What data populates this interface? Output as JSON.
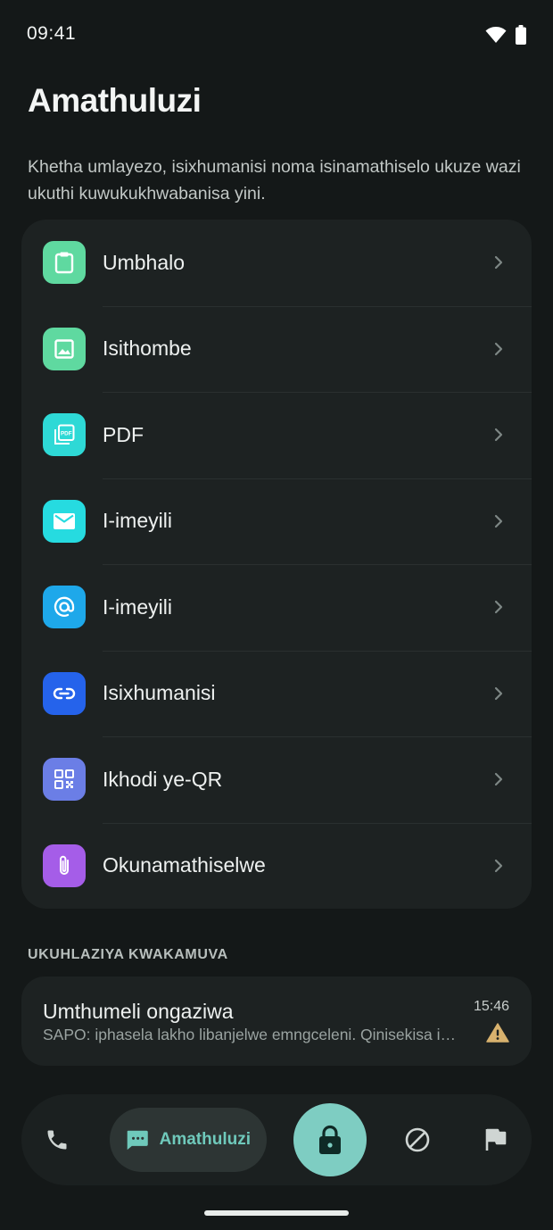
{
  "status_bar": {
    "time": "09:41"
  },
  "header": {
    "title": "Amathuluzi",
    "description": "Khetha umlayezo, isixhumanisi noma isinamathiselo ukuze wazi ukuthi kuwukukhwabanisa yini."
  },
  "tools": [
    {
      "label": "Umbhalo",
      "icon": "clipboard-icon",
      "color": "#5fd9a0"
    },
    {
      "label": "Isithombe",
      "icon": "image-icon",
      "color": "#5fd9a0"
    },
    {
      "label": "PDF",
      "icon": "pdf-icon",
      "color": "#2ed9d6"
    },
    {
      "label": "I-imeyili",
      "icon": "mail-icon",
      "color": "#26dbe0"
    },
    {
      "label": "I-imeyili",
      "icon": "at-icon",
      "color": "#1ea8ea"
    },
    {
      "label": "Isixhumanisi",
      "icon": "link-icon",
      "color": "#2563eb"
    },
    {
      "label": "Ikhodi ye-QR",
      "icon": "qr-code-icon",
      "color": "#6b7ee6"
    },
    {
      "label": "Okunamathiselwe",
      "icon": "paperclip-icon",
      "color": "#a55de8"
    }
  ],
  "recent": {
    "heading": "UKUHLAZIYA KWAKAMUVA",
    "items": [
      {
        "sender": "Umthumeli ongaziwa",
        "preview": "SAPO: iphasela lakho libanjelwe emngceleni. Qinisekisa imali yokulethwa ukuze uyithole.",
        "time": "15:46",
        "status_icon": "warning-icon",
        "status_color": "#d8b26e"
      }
    ]
  },
  "bottom_nav": {
    "active_label": "Amathuluzi",
    "accent": "#6fc9bb",
    "fab_color": "#7ecdc2"
  }
}
